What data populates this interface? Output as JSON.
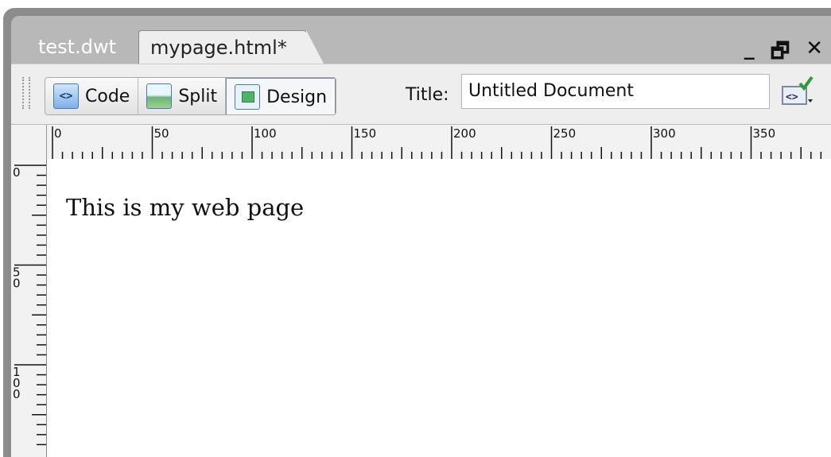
{
  "tabs": [
    {
      "label": "test.dwt",
      "active": false
    },
    {
      "label": "mypage.html*",
      "active": true
    }
  ],
  "window_controls": {
    "minimize": "_",
    "restore": "🗗",
    "close": "✕"
  },
  "toolbar": {
    "code_label": "Code",
    "split_label": "Split",
    "design_label": "Design",
    "active_view": "Design",
    "title_label": "Title:",
    "title_value": "Untitled Document"
  },
  "ruler": {
    "horizontal_labels": [
      "0",
      "50",
      "100",
      "150",
      "200",
      "250",
      "300",
      "350"
    ],
    "vertical_labels": [
      "0",
      "5 0",
      "1 0 0"
    ]
  },
  "page": {
    "body_text": "This is my web page"
  },
  "colors": {
    "frame": "#8c8c8c",
    "toolbar": "#eeeeee",
    "ruler": "#f2f2f2",
    "accent_blue": "#4a78a8"
  }
}
